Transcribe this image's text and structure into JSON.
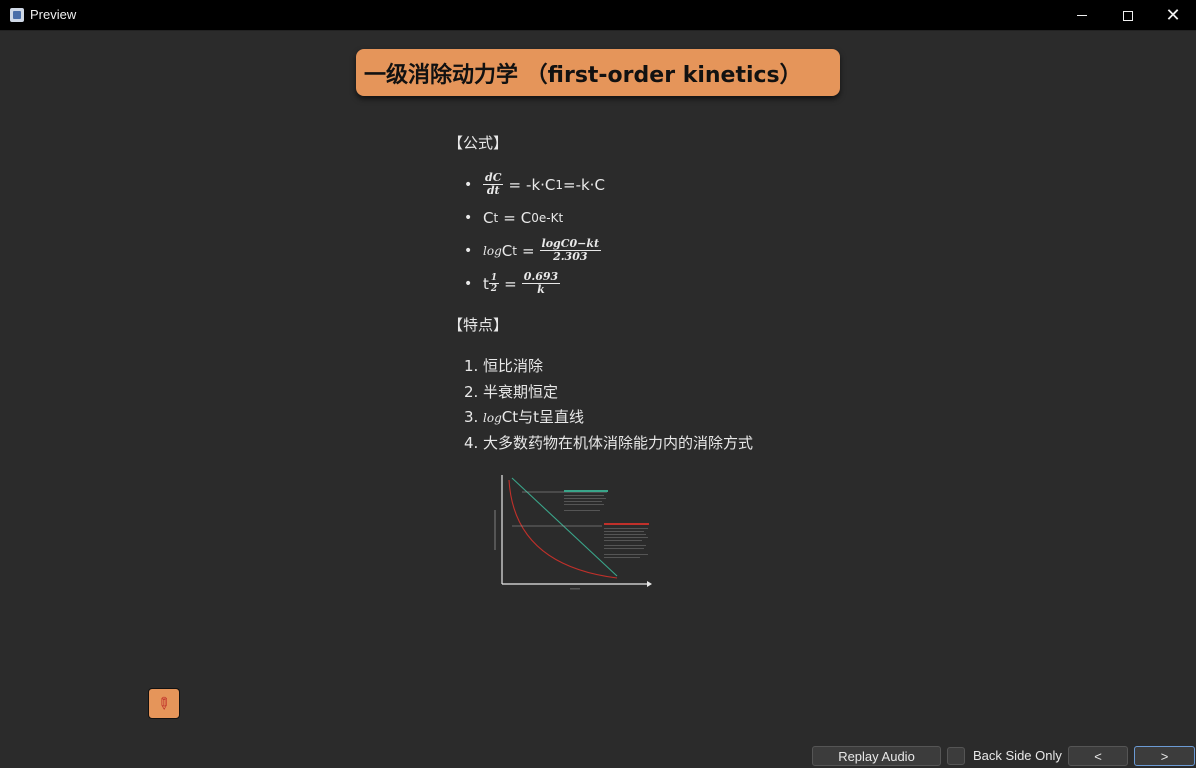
{
  "window": {
    "title": "Preview",
    "minimize": "—",
    "maximize": "☐",
    "close": "✕"
  },
  "card": {
    "title": "一级消除动力学 （first-order kinetics）",
    "formula_heading": "【公式】",
    "formulas": {
      "f1": {
        "num": "dC",
        "den": "dt",
        "eq": "=",
        "rhs": "-k·C",
        "sub": "1",
        "tail": "=-k·C"
      },
      "f2": {
        "lhs": "C",
        "lhs_sub": "t",
        "eq": "=",
        "rhs": "C",
        "rhs_sub": "0",
        "sup": "e-Kt"
      },
      "f3": {
        "log": "log",
        "lhs": "C",
        "lhs_sub": "t",
        "eq": "=",
        "num": "logC0−kt",
        "den": "2.303"
      },
      "f4": {
        "lhs": "t",
        "half_num": "1",
        "half_den": "2",
        "eq": "=",
        "num": "0.693",
        "den": "k"
      }
    },
    "features_heading": "【特点】",
    "features": [
      {
        "idx": "1.",
        "text": "恒比消除"
      },
      {
        "idx": "2.",
        "text": "半衰期恒定"
      },
      {
        "idx": "3.",
        "log": "log",
        "text": "Ct与t呈直线"
      },
      {
        "idx": "4.",
        "text": "大多数药物在机体消除能力内的消除方式"
      }
    ]
  },
  "footer": {
    "replay_label": "Replay Audio",
    "back_side_label": "Back Side Only",
    "back_side_checked": false,
    "prev_label": "<",
    "next_label": ">"
  },
  "pin": {
    "icon": "pin-icon"
  },
  "colors": {
    "accent": "#e5955a",
    "background": "#2b2b2b",
    "titlebar": "#000000",
    "focus": "#6b9ad4"
  }
}
